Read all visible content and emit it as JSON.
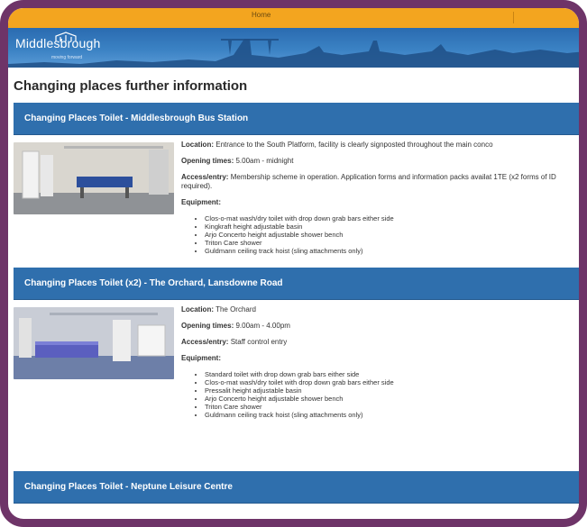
{
  "topbar": {
    "home_label": "Home"
  },
  "banner": {
    "logo_text": "Middlesbrough",
    "tagline": "moving forward"
  },
  "page": {
    "title": "Changing places further information"
  },
  "sections": [
    {
      "heading": "Changing Places Toilet - Middlesbrough Bus Station",
      "location_label": "Location:",
      "location": "Entrance to the South Platform, facility is clearly signposted throughout the main conco",
      "opening_label": "Opening times:",
      "opening": "5.00am - midnight",
      "access_label": "Access/entry:",
      "access": "Membership scheme in operation. Application forms and information packs availat 1TE (x2 forms of ID required).",
      "equipment_label": "Equipment:",
      "equipment": [
        "Clos-o-mat wash/dry toilet with drop down grab bars either side",
        "Kingkraft height adjustable basin",
        "Arjo Concerto height adjustable shower bench",
        "Triton Care shower",
        "Guldmann ceiling track hoist (sling attachments only)"
      ]
    },
    {
      "heading": "Changing Places Toilet (x2) - The Orchard, Lansdowne Road",
      "location_label": "Location:",
      "location": "The Orchard",
      "opening_label": "Opening times:",
      "opening": "9.00am - 4.00pm",
      "access_label": "Access/entry:",
      "access": "Staff control entry",
      "equipment_label": "Equipment:",
      "equipment": [
        "Standard toilet with drop down grab bars either side",
        "Clos-o-mat wash/dry toilet with drop down grab bars either side",
        "Pressalit height adjustable basin",
        "Arjo Concerto height adjustable shower bench",
        "Triton Care shower",
        "Guldmann ceiling track hoist (sling attachments only)"
      ]
    },
    {
      "heading": "Changing Places Toilet - Neptune Leisure Centre"
    }
  ],
  "colors": {
    "frame": "#6e3468",
    "topbar": "#f3a51f",
    "section_header": "#2f6fad"
  }
}
